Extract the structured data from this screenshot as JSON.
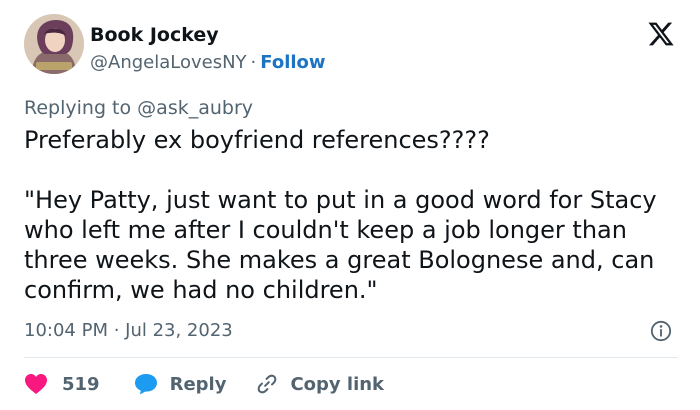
{
  "author": {
    "display_name": "Book Jockey",
    "handle": "@AngelaLovesNY",
    "separator": "·",
    "follow_label": "Follow",
    "avatar_icon": "avatar-portrait"
  },
  "logo_icon": "x-logo-icon",
  "reply_context": {
    "prefix": "Replying to",
    "mention": "@ask_aubry"
  },
  "tweet": {
    "line1": "Preferably ex boyfriend references????",
    "line2": "\"Hey Patty, just want to put in a good word for Stacy who left me after I couldn't keep a job longer than three weeks. She makes a great Bolognese and, can confirm, we had no children.\""
  },
  "meta": {
    "timestamp": "10:04 PM · Jul 23, 2023",
    "info_icon": "info-icon"
  },
  "actions": {
    "like_count": "519",
    "reply_label": "Reply",
    "copy_label": "Copy link"
  },
  "colors": {
    "accent": "#1d74c3",
    "like": "#f91880",
    "reply_icon": "#1d9bf0",
    "muted": "#536471",
    "text": "#0f1419"
  }
}
